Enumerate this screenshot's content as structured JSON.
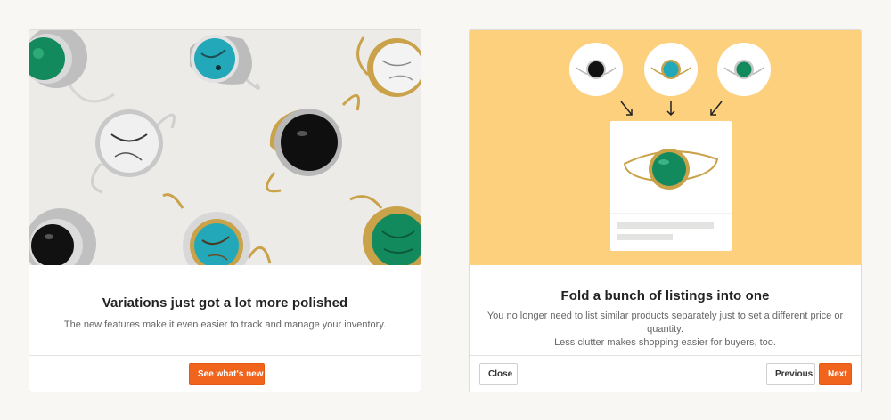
{
  "cards": [
    {
      "title": "Variations just got a lot more polished",
      "description": [
        "The new features make it even easier to track and manage your inventory."
      ],
      "buttons": {
        "primary": "See what's new"
      },
      "hero": "photo of gemstone rings"
    },
    {
      "title": "Fold a bunch of listings into one",
      "description": [
        "You no longer need to list similar products separately just to set a different price or quantity.",
        "Less clutter makes shopping easier for buyers, too."
      ],
      "buttons": {
        "close": "Close",
        "previous": "Previous",
        "next": "Next"
      },
      "hero": "illustration of three ring listings merging into one"
    }
  ],
  "colors": {
    "page_background": "#f8f7f4",
    "primary_button": "#f1641e",
    "illustration_background": "#fdd07e",
    "malachite": "#138a5e",
    "turquoise": "#22a8b8",
    "onyx": "#111111",
    "howlite": "#f0f0f0",
    "gold": "#c9a24a",
    "silver": "#c8c8c8"
  }
}
